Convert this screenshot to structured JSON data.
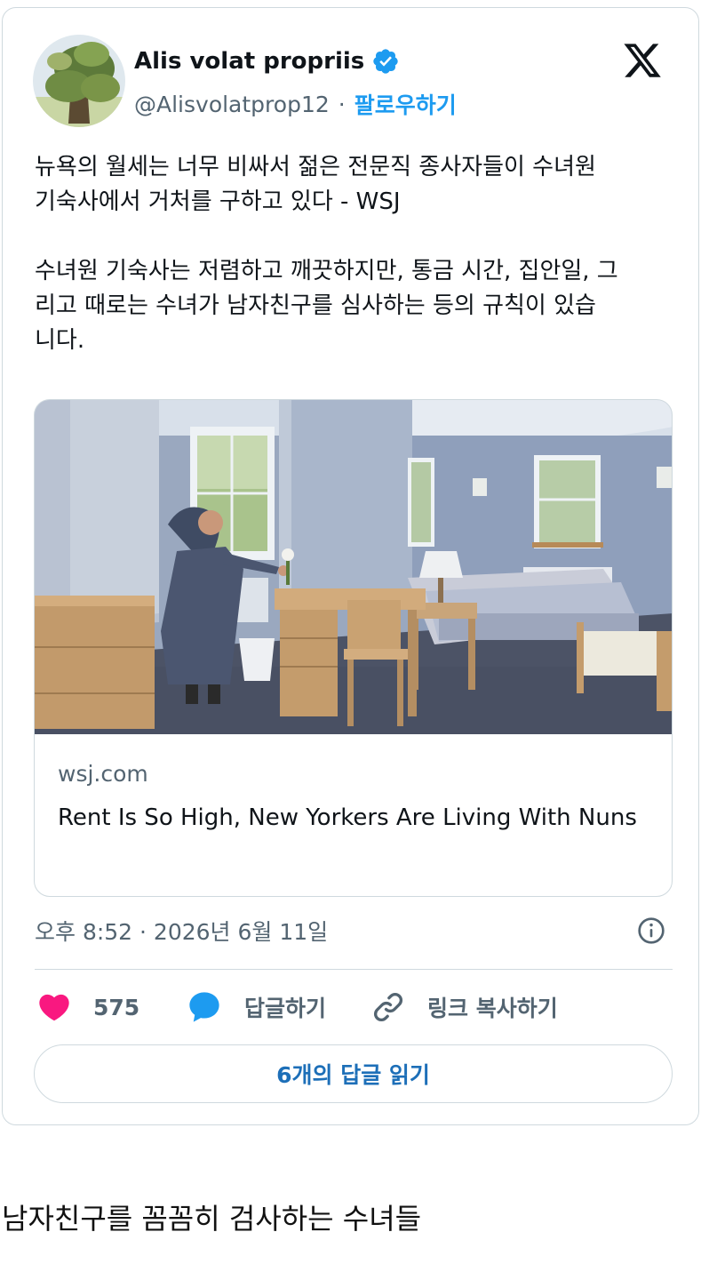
{
  "tweet": {
    "author_name": "Alis volat propriis",
    "handle": "@Alisvolatprop12",
    "separator": "·",
    "follow_label": "팔로우하기",
    "text_paragraph_1": "뉴욕의 월세는 너무 비싸서 젊은 전문직 종사자들이 수녀원\n기숙사에서 거처를 구하고 있다 - WSJ",
    "text_paragraph_2": "수녀원 기숙사는 저렴하고 깨끗하지만, 통금 시간, 집안일, 그\n리고 때로는 수녀가 남자친구를 심사하는 등의 규칙이 있습\n니다.",
    "link_card": {
      "domain": "wsj.com",
      "title": "Rent Is So High, New Yorkers Are Living With Nuns"
    },
    "timestamp": "오후 8:52 · 2026년 6월 11일",
    "likes_count": "575",
    "reply_label": "답글하기",
    "copy_link_label": "링크 복사하기",
    "read_replies_label": "6개의 답글 읽기"
  },
  "caption": "남자친구를 꼼꼼히 검사하는 수녀들",
  "icons": {
    "verified": "verified-badge-icon",
    "x_logo": "x-logo-icon",
    "info": "info-icon",
    "like": "heart-icon",
    "reply": "speech-bubble-icon",
    "copy": "link-icon"
  },
  "colors": {
    "accent_blue": "#1d9bf0",
    "heart": "#f91880",
    "text_secondary": "#536471",
    "border": "#cfd9de"
  }
}
